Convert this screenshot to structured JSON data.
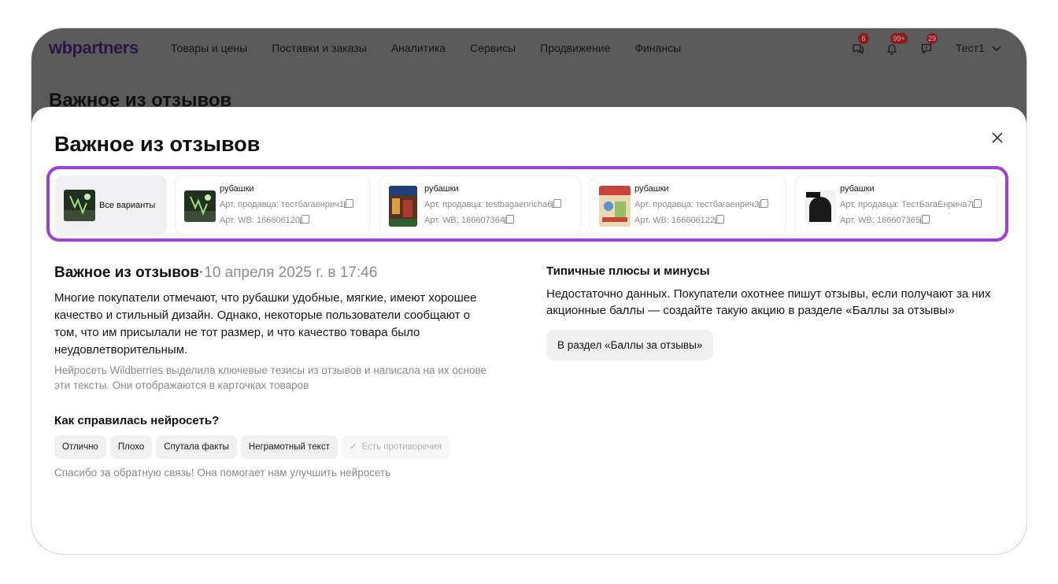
{
  "header": {
    "logo": "wbpartners",
    "nav": [
      "Товары и цены",
      "Поставки и заказы",
      "Аналитика",
      "Сервисы",
      "Продвижение",
      "Финансы"
    ],
    "badges": {
      "chat": "6",
      "notifications": "99+",
      "support": "29"
    },
    "user": "Тест1"
  },
  "background_title": "Важное из отзывов",
  "modal": {
    "title": "Важное из отзывов",
    "variants": {
      "all_label": "Все варианты",
      "items": [
        {
          "category": "рубашки",
          "seller_art": "Арт. продавца: тестбагаенрич1",
          "wb_art": "Арт. WB: 166606120"
        },
        {
          "category": "рубашки",
          "seller_art": "Арт. продавца: testbagaenricha6",
          "wb_art": "Арт. WB: 166607364"
        },
        {
          "category": "рубашки",
          "seller_art": "Арт. продавца: тестбагаенрич3",
          "wb_art": "Арт. WB: 166606122"
        },
        {
          "category": "рубашки",
          "seller_art": "Арт. продавца: ТестБагаЕнрича7",
          "wb_art": "Арт. WB: 166607365"
        }
      ]
    },
    "summary": {
      "heading": "Важное из отзывов",
      "separator": "·",
      "date": "10 апреля 2025 г. в 17:46",
      "text": "Многие покупатели отмечают, что рубашки удобные, мягкие, имеют хорошее качество и стильный дизайн. Однако, некоторые пользователи сообщают о том, что им присылали не тот размер, и что качество товара было неудовлетворительным.",
      "note": "Нейросеть Wildberries выделила ключевые тезисы из отзывов и написала на их основе эти тексты. Они отображаются в карточках товаров"
    },
    "rating": {
      "heading": "Как справилась нейросеть?",
      "chips": [
        "Отлично",
        "Плохо",
        "Спутала факты",
        "Неграмотный текст"
      ],
      "muted_chip": "Есть противоречия",
      "thanks": "Спасибо за обратную связь! Она помогает нам улучшить нейросеть"
    },
    "pros_cons": {
      "heading": "Типичные плюсы и минусы",
      "text": "Недостаточно данных. Покупатели охотнее пишут отзывы, если получают за них акционные баллы — создайте такую акцию в разделе «Баллы за отзывы»",
      "button": "В раздел «Баллы за отзывы»"
    }
  }
}
